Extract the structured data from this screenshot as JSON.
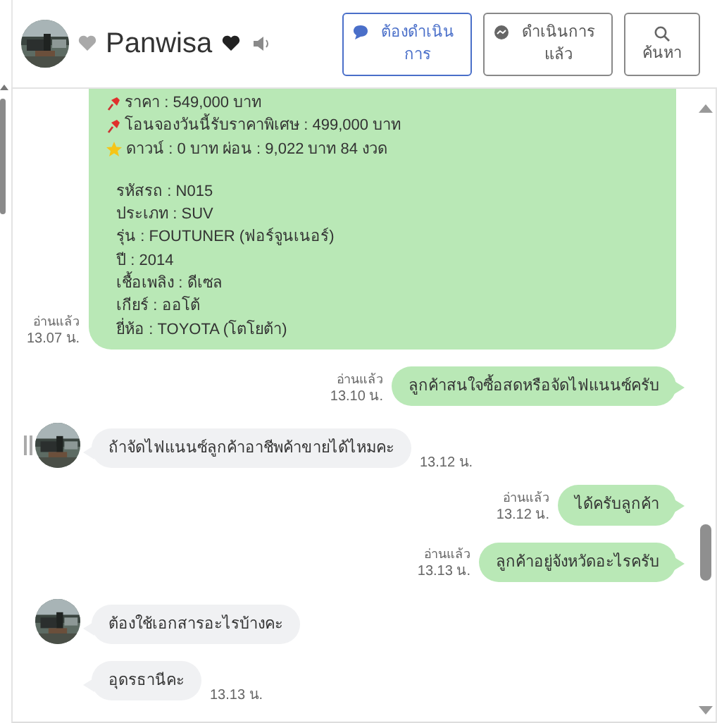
{
  "header": {
    "name": "Panwisa",
    "buttons": [
      {
        "label": "ต้องดำเนินการ",
        "selected": true
      },
      {
        "label": "ดำเนินการแล้ว",
        "selected": false
      },
      {
        "label": "ค้นหา",
        "selected": false
      }
    ]
  },
  "messages": [
    {
      "kind": "outgoing",
      "read": "อ่านแล้ว",
      "time": "13.07 น.",
      "lines": [
        {
          "kind": "pin",
          "text": "ราคา : 549,000 บาท"
        },
        {
          "kind": "pin",
          "text": "โอนจองวันนี้รับราคาพิเศษ : 499,000 บาท"
        },
        {
          "kind": "star",
          "text": "ดาวน์ : 0 บาท ผ่อน : 9,022 บาท 84 งวด"
        },
        {
          "kind": "blank"
        },
        {
          "kind": "text",
          "text": "รหัสรถ : N015"
        },
        {
          "kind": "text",
          "text": "ประเภท : SUV"
        },
        {
          "kind": "text",
          "text": "รุ่น : FOUTUNER (ฟอร์จูนเนอร์)"
        },
        {
          "kind": "text",
          "text": "ปี : 2014"
        },
        {
          "kind": "text",
          "text": "เชื้อเพลิง : ดีเซล"
        },
        {
          "kind": "text",
          "text": "เกียร์ : ออโต้"
        },
        {
          "kind": "text",
          "text": "ยี่ห้อ : TOYOTA (โตโยต้า)"
        }
      ]
    },
    {
      "kind": "outgoing",
      "read": "อ่านแล้ว",
      "time": "13.10 น.",
      "lines": [
        {
          "kind": "text",
          "text": "ลูกค้าสนใจซื้อสดหรือจัดไฟแนนซ์ครับ"
        }
      ]
    },
    {
      "kind": "incoming",
      "avatar": true,
      "handle": true,
      "time": "13.12 น.",
      "lines": [
        {
          "kind": "text",
          "text": "ถ้าจัดไฟแนนซ์ลูกค้าอาชีพค้าขายได้ไหมคะ"
        }
      ]
    },
    {
      "kind": "outgoing",
      "read": "อ่านแล้ว",
      "time": "13.12 น.",
      "lines": [
        {
          "kind": "text",
          "text": "ได้ครับลูกค้า"
        }
      ]
    },
    {
      "kind": "outgoing",
      "read": "อ่านแล้ว",
      "time": "13.13 น.",
      "lines": [
        {
          "kind": "text",
          "text": "ลูกค้าอยู่จังหวัดอะไรครับ"
        }
      ]
    },
    {
      "kind": "incoming",
      "avatar": true,
      "handle": false,
      "lines": [
        {
          "kind": "text",
          "text": "ต้องใช้เอกสารอะไรบ้างคะ"
        }
      ]
    },
    {
      "kind": "incoming",
      "avatar": false,
      "handle": false,
      "time": "13.13 น.",
      "lines": [
        {
          "kind": "text",
          "text": "อุดรธานีคะ"
        }
      ]
    }
  ]
}
